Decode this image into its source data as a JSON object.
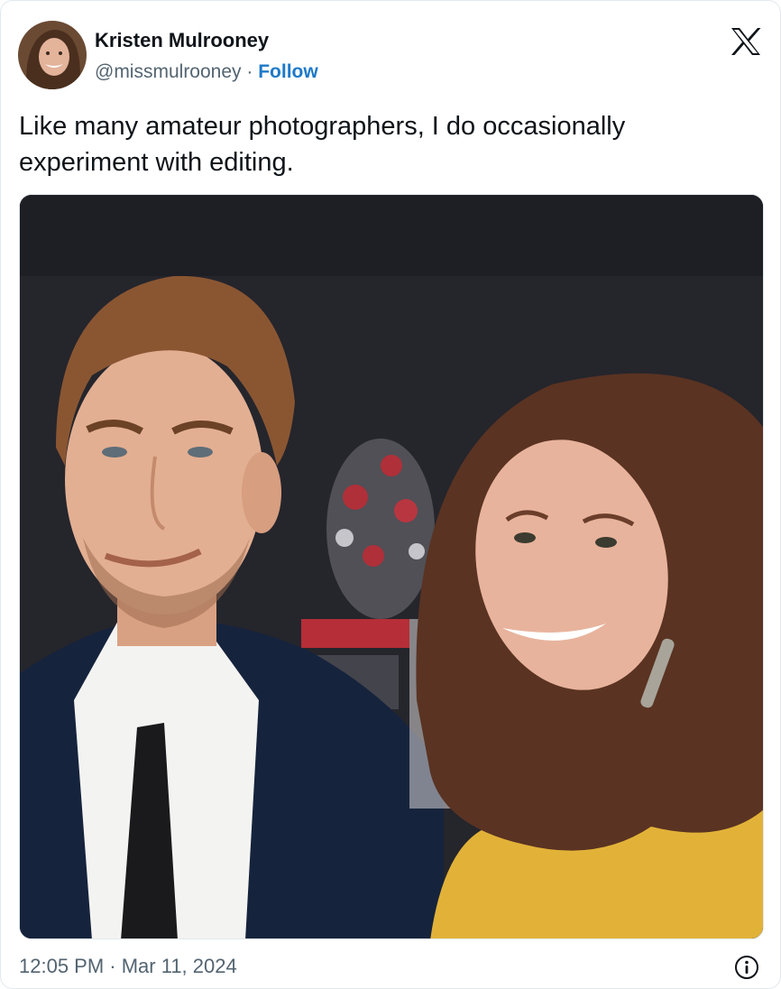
{
  "author": {
    "name": "Kristen Mulrooney",
    "handle": "@missmulrooney",
    "separator": "·",
    "follow_label": "Follow"
  },
  "tweet": {
    "text": "Like many amateur photographers, I do occasionally experiment with editing."
  },
  "footer": {
    "timestamp": "12:05 PM · Mar 11, 2024"
  },
  "icons": {
    "brand": "x-logo-icon",
    "info": "info-icon"
  },
  "colors": {
    "text": "#0f1419",
    "secondary": "#536471",
    "follow": "#1d79c8"
  }
}
